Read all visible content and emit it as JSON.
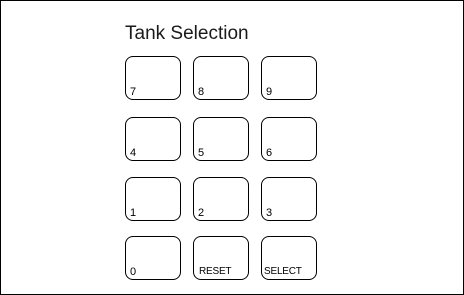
{
  "title": "Tank Selection",
  "keypad": {
    "rows": [
      [
        {
          "label": "7"
        },
        {
          "label": "8"
        },
        {
          "label": "9"
        }
      ],
      [
        {
          "label": "4"
        },
        {
          "label": "5"
        },
        {
          "label": "6"
        }
      ],
      [
        {
          "label": "1"
        },
        {
          "label": "2"
        },
        {
          "label": "3"
        }
      ],
      [
        {
          "label": "0"
        },
        {
          "label": "RESET"
        },
        {
          "label": "SELECT"
        }
      ]
    ]
  }
}
